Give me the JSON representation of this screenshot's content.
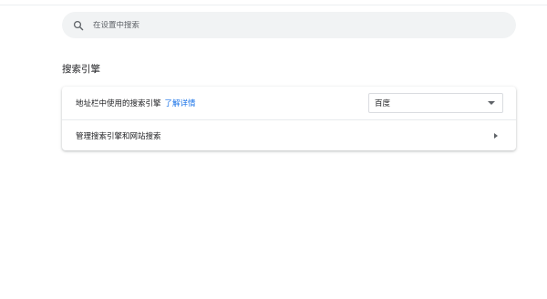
{
  "search": {
    "placeholder": "在设置中搜索",
    "icon": "search-icon"
  },
  "section": {
    "title": "搜索引擎"
  },
  "engine_row": {
    "label": "地址栏中使用的搜索引擎",
    "learn_more": "了解详情",
    "selected_engine": "百度",
    "dropdown_icon": "chevron-down-icon"
  },
  "manage_row": {
    "label": "管理搜索引擎和网站搜索",
    "arrow_icon": "chevron-right-icon"
  },
  "colors": {
    "link": "#1a73e8",
    "search_background": "#f1f3f4",
    "text": "#202124",
    "secondary_text": "#5f6368"
  }
}
